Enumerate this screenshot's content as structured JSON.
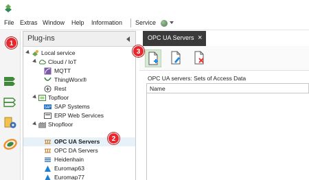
{
  "menu": {
    "items": [
      "File",
      "Extras",
      "Window",
      "Help",
      "Information"
    ],
    "service_label": "Service",
    "service_status_color": "#5b8a57"
  },
  "plugins_panel": {
    "title": "Plug-ins",
    "tree": [
      {
        "label": "Local service",
        "icon": "local-service-icon",
        "expanded": true,
        "level": 0
      },
      {
        "label": "Cloud / IoT",
        "icon": "cloud-icon",
        "expanded": true,
        "level": 1
      },
      {
        "label": "MQTT",
        "icon": "mqtt-icon",
        "level": 2
      },
      {
        "label": "ThingWorx®",
        "icon": "thingworx-icon",
        "level": 2
      },
      {
        "label": "Rest",
        "icon": "rest-icon",
        "level": 2
      },
      {
        "label": "Topfloor",
        "icon": "topfloor-icon",
        "expanded": true,
        "level": 1
      },
      {
        "label": "SAP Systems",
        "icon": "sap-icon",
        "level": 2
      },
      {
        "label": "ERP Web Services",
        "icon": "erp-icon",
        "level": 2
      },
      {
        "label": "Shopfloor",
        "icon": "shopfloor-icon",
        "expanded": true,
        "level": 1
      },
      {
        "label": "OPC UA Servers",
        "icon": "opc-ua-icon",
        "level": 2,
        "selected": true
      },
      {
        "label": "OPC DA Servers",
        "icon": "opc-da-icon",
        "level": 2
      },
      {
        "label": "Heidenhain",
        "icon": "heidenhain-icon",
        "level": 2
      },
      {
        "label": "Euromap63",
        "icon": "euromap-icon",
        "level": 2
      },
      {
        "label": "Euromap77",
        "icon": "euromap-icon",
        "level": 2
      }
    ]
  },
  "document_tab": {
    "title": "OPC UA Servers",
    "close_glyph": "×"
  },
  "toolbar": {
    "buttons": [
      {
        "name": "new-entry-icon",
        "active": true
      },
      {
        "name": "edit-entry-icon",
        "active": false
      },
      {
        "name": "delete-entry-icon",
        "active": false
      }
    ]
  },
  "content": {
    "section_label": "OPC UA servers: Sets of Access Data",
    "columns": [
      "Name"
    ]
  },
  "callouts": [
    "1",
    "2",
    "3"
  ],
  "colors": {
    "callout": "#e8262b",
    "tab_active": "#3a3a3a",
    "selection": "#e6f1f8",
    "accent_green": "#3f8a3a"
  }
}
